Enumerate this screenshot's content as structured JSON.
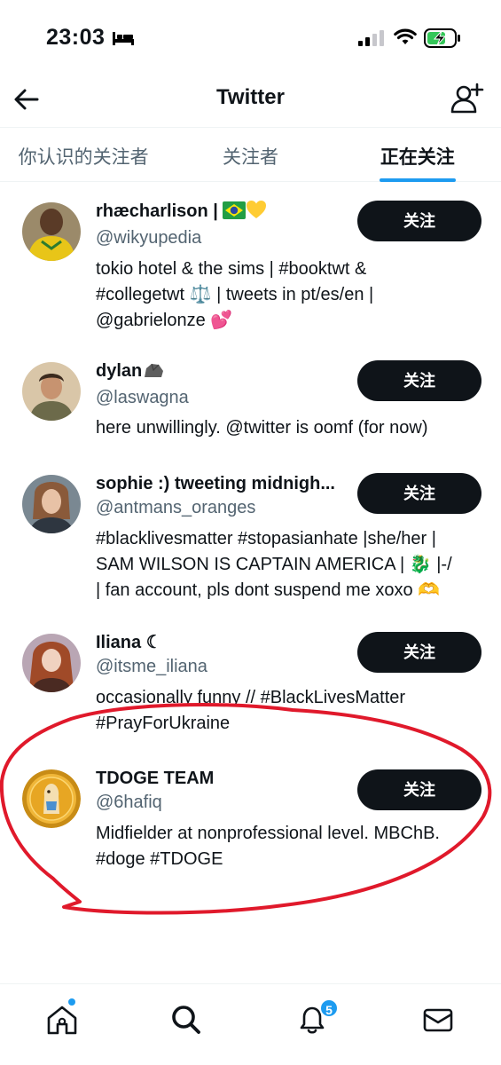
{
  "status_bar": {
    "time": "23:03"
  },
  "header": {
    "title": "Twitter"
  },
  "tabs": [
    {
      "label": "你认识的关注者"
    },
    {
      "label": "关注者"
    },
    {
      "label": "正在关注"
    }
  ],
  "users": [
    {
      "name": "rhæcharlison |",
      "handle": "@wikyupedia",
      "bio_lines": [
        "tokio hotel & the sims | #booktwt &",
        "#collegetwt ⚖️ | tweets in pt/es/en |",
        "@gabrielonze 💕"
      ],
      "button": "关注"
    },
    {
      "name": "dylan",
      "handle": "@laswagna",
      "bio_lines": [
        "here unwillingly. @twitter is oomf (for now)"
      ],
      "button": "关注"
    },
    {
      "name": "sophie :) tweeting midnigh...",
      "handle": "@antmans_oranges",
      "bio_lines": [
        "#blacklivesmatter #stopasianhate |she/her |",
        "SAM WILSON IS CAPTAIN AMERICA | 🐉 |-/",
        "| fan account, pls dont suspend me xoxo 🫶"
      ],
      "button": "关注"
    },
    {
      "name": "Iliana ☾",
      "handle": "@itsme_iliana",
      "bio_lines": [
        "occasionally funny // #BlackLivesMatter",
        "#PrayForUkraine"
      ],
      "button": "关注"
    },
    {
      "name": "TDOGE TEAM",
      "handle": "@6hafiq",
      "bio_lines": [
        "Midfielder at nonprofessional level. MBChB.",
        "#doge #TDOGE"
      ],
      "button": "关注"
    }
  ],
  "bottom_nav": {
    "items": [
      "home-icon",
      "search-icon",
      "bell-icon",
      "mail-icon"
    ],
    "notification_count": "5"
  },
  "colors": {
    "accent": "#1d9bf0",
    "button": "#0f1419",
    "annotation": "#e0192b"
  }
}
